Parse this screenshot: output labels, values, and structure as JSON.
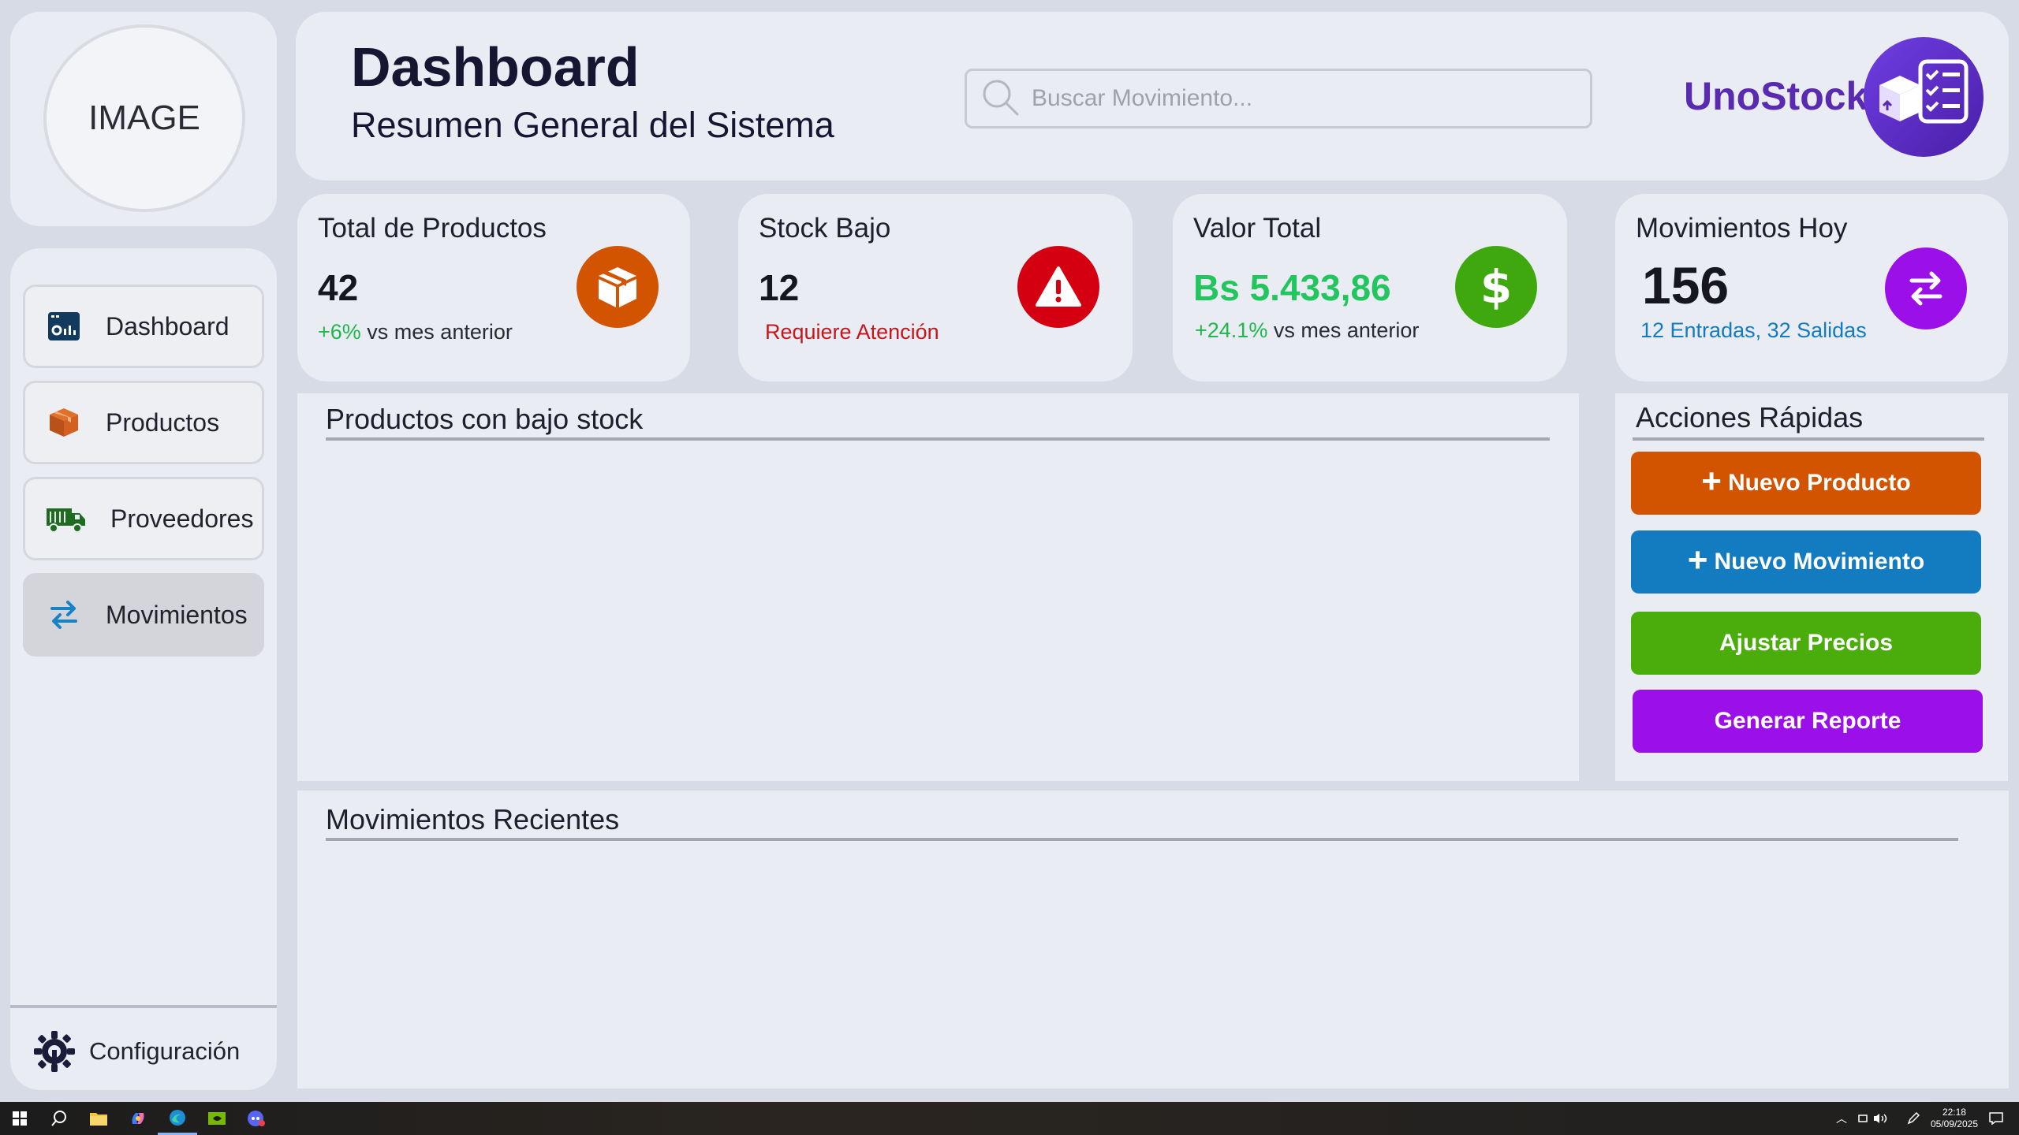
{
  "profile": {
    "image_placeholder": "IMAGE"
  },
  "sidebar": {
    "items": [
      {
        "label": "Dashboard",
        "icon": "dashboard-icon"
      },
      {
        "label": "Productos",
        "icon": "box-icon"
      },
      {
        "label": "Proveedores",
        "icon": "truck-icon"
      },
      {
        "label": "Movimientos",
        "icon": "arrows-exchange-icon",
        "active": true
      }
    ],
    "settings_label": "Configuración"
  },
  "header": {
    "title": "Dashboard",
    "subtitle": "Resumen General del Sistema",
    "search_placeholder": "Buscar Movimiento...",
    "brand": "UnoStock"
  },
  "stats": {
    "products": {
      "label": "Total de Productos",
      "value": "42",
      "delta": "+6%",
      "delta_suffix": " vs mes anterior",
      "icon": "box-icon",
      "color": "#d35400"
    },
    "low_stock": {
      "label": "Stock Bajo",
      "value": "12",
      "note": "Requiere Atención",
      "icon": "warning-icon",
      "color": "#d40012"
    },
    "total_value": {
      "label": "Valor Total",
      "value": "Bs 5.433,86",
      "delta": "+24.1%",
      "delta_suffix": " vs mes anterior",
      "icon": "dollar-icon",
      "color": "#3fa80f"
    },
    "moves_today": {
      "label": "Movimientos Hoy",
      "value": "156",
      "note": "12 Entradas, 32 Salidas",
      "icon": "arrows-exchange-icon",
      "color": "#9b0fe8"
    }
  },
  "low_stock_panel": {
    "title": "Productos con bajo stock"
  },
  "quick_actions": {
    "title": "Acciones Rápidas",
    "buttons": [
      {
        "label": "Nuevo Producto",
        "color": "#d35400"
      },
      {
        "label": "Nuevo Movimiento",
        "color": "#137bbf"
      },
      {
        "label": "Ajustar Precios",
        "color": "#4aad0c"
      },
      {
        "label": "Generar Reporte",
        "color": "#9b0fe8"
      }
    ]
  },
  "recent_panel": {
    "title": "Movimientos Recientes"
  },
  "taskbar": {
    "time": "22:18",
    "date": "05/09/2025"
  }
}
